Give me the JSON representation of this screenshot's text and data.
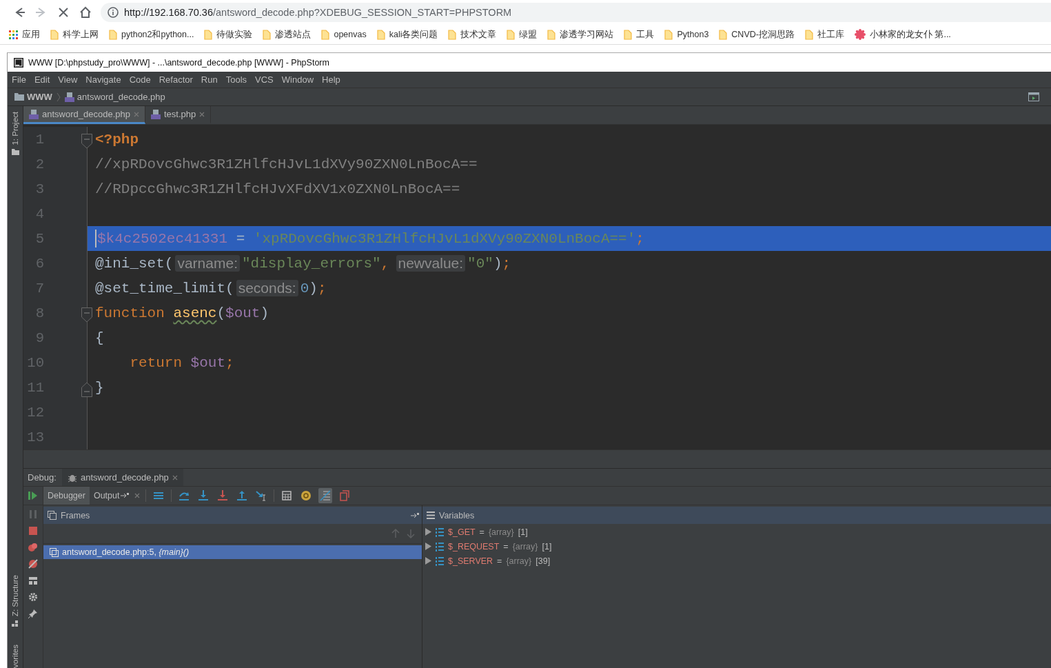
{
  "browser": {
    "url_host": "http://192.168.70.36",
    "url_path": "/antsword_decode.php?XDEBUG_SESSION_START=PHPSTORM",
    "bookmarks": [
      {
        "label": "应用",
        "kind": "apps"
      },
      {
        "label": "科学上网",
        "kind": "folder"
      },
      {
        "label": "python2和python...",
        "kind": "folder"
      },
      {
        "label": "待做实验",
        "kind": "folder"
      },
      {
        "label": "渗透站点",
        "kind": "folder"
      },
      {
        "label": "openvas",
        "kind": "folder"
      },
      {
        "label": "kali各类问题",
        "kind": "folder"
      },
      {
        "label": "技术文章",
        "kind": "folder"
      },
      {
        "label": "绿盟",
        "kind": "folder"
      },
      {
        "label": "渗透学习网站",
        "kind": "folder"
      },
      {
        "label": "工具",
        "kind": "folder"
      },
      {
        "label": "Python3",
        "kind": "folder"
      },
      {
        "label": "CNVD-挖洞思路",
        "kind": "folder"
      },
      {
        "label": "社工库",
        "kind": "folder"
      },
      {
        "label": "小林家的龙女仆 第...",
        "kind": "page"
      }
    ]
  },
  "ide": {
    "title": "WWW [D:\\phpstudy_pro\\WWW] - ...\\antsword_decode.php [WWW] - PhpStorm",
    "menu": [
      "File",
      "Edit",
      "View",
      "Navigate",
      "Code",
      "Refactor",
      "Run",
      "Tools",
      "VCS",
      "Window",
      "Help"
    ],
    "breadcrumb": [
      "WWW",
      "antsword_decode.php"
    ],
    "side_tools": [
      {
        "label": "1: Project",
        "kind": "project"
      },
      {
        "label": "Z: Structure",
        "kind": "structure"
      },
      {
        "label": "vorites",
        "kind": "favorites"
      }
    ],
    "tabs": [
      {
        "label": "antsword_decode.php",
        "selected": true
      },
      {
        "label": "test.php",
        "selected": false
      }
    ],
    "editor": {
      "lines": [
        {
          "number": "1",
          "kind": "opener",
          "selected": false,
          "tokens": [
            {
              "kind": "tag",
              "text": "<?php"
            }
          ]
        },
        {
          "number": "2",
          "kind": "plain",
          "selected": false,
          "tokens": [
            {
              "kind": "comment",
              "text": "//xpRDovcGhwc3R1ZHlfcHJvL1dXVy90ZXN0LnBocA=="
            }
          ]
        },
        {
          "number": "3",
          "kind": "plain",
          "selected": false,
          "tokens": [
            {
              "kind": "comment",
              "text": "//RDpccGhwc3R1ZHlfcHJvXFdXV1x0ZXN0LnBocA=="
            }
          ]
        },
        {
          "number": "4",
          "kind": "plain",
          "selected": false
        },
        {
          "number": "5",
          "kind": "plain",
          "selected": true,
          "tokens": [
            {
              "kind": "var",
              "text": "$k4c2502ec41331"
            },
            {
              "kind": "op",
              "text": "="
            },
            {
              "kind": "string",
              "text": "'xpRDovcGhwc3R1ZHlfcHJvL1dXVy90ZXN0LnBocA=='"
            },
            {
              "kind": "punct",
              "text": ";"
            }
          ]
        },
        {
          "number": "6",
          "kind": "plain",
          "selected": false,
          "tokens": [
            {
              "kind": "plain",
              "text": "@ini_set("
            },
            {
              "kind": "hint",
              "text": "varname:"
            },
            {
              "kind": "string",
              "text": "\"display_errors\""
            },
            {
              "kind": "punct",
              "text": ","
            },
            {
              "kind": "hint",
              "text": "newvalue:"
            },
            {
              "kind": "string",
              "text": "\"0\""
            },
            {
              "kind": "plain",
              "text": ")"
            },
            {
              "kind": "punct",
              "text": ";"
            }
          ]
        },
        {
          "number": "7",
          "kind": "plain",
          "selected": false,
          "tokens": [
            {
              "kind": "plain",
              "text": "@set_time_limit("
            },
            {
              "kind": "hint",
              "text": "seconds:"
            },
            {
              "kind": "number",
              "text": "0"
            },
            {
              "kind": "plain",
              "text": ")"
            },
            {
              "kind": "punct",
              "text": ";"
            }
          ]
        },
        {
          "number": "8",
          "kind": "opener",
          "selected": false,
          "tokens": [
            {
              "kind": "keyword",
              "text": "function"
            },
            {
              "kind": "func",
              "text": "asenc"
            },
            {
              "kind": "plain",
              "text": "("
            },
            {
              "kind": "var",
              "text": "$out"
            },
            {
              "kind": "plain",
              "text": ")"
            }
          ]
        },
        {
          "number": "9",
          "kind": "plain",
          "selected": false,
          "tokens": [
            {
              "kind": "plain",
              "text": "{"
            }
          ]
        },
        {
          "number": "10",
          "kind": "indented",
          "selected": false,
          "tokens": [
            {
              "kind": "keyword",
              "text": "return"
            },
            {
              "kind": "var",
              "text": "$out"
            },
            {
              "kind": "punct",
              "text": ";"
            }
          ]
        },
        {
          "number": "11",
          "kind": "closer",
          "selected": false,
          "tokens": [
            {
              "kind": "plain",
              "text": "}"
            }
          ]
        },
        {
          "number": "12",
          "kind": "plain",
          "selected": false
        },
        {
          "number": "13",
          "kind": "plain",
          "selected": false
        }
      ]
    },
    "debug": {
      "label": "Debug:",
      "session_tab": "antsword_decode.php",
      "tabs": [
        {
          "label": "Debugger",
          "selected": true
        },
        {
          "label": "Output",
          "selected": false
        }
      ],
      "frames": {
        "title": "Frames",
        "items": [
          {
            "text": "antsword_decode.php:5, *{main}()*",
            "selected": true
          }
        ]
      },
      "variables": {
        "title": "Variables",
        "items": [
          {
            "name": "$_GET",
            "op": "=",
            "type": "{array}",
            "count": "[1]"
          },
          {
            "name": "$_REQUEST",
            "op": "=",
            "type": "{array}",
            "count": "[1]"
          },
          {
            "name": "$_SERVER",
            "op": "=",
            "type": "{array}",
            "count": "[39]"
          }
        ]
      }
    }
  }
}
